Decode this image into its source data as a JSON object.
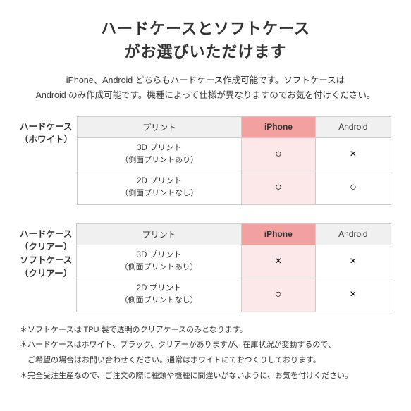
{
  "title": {
    "line1": "ハードケースとソフトケース",
    "line2": "がお選びいただけます"
  },
  "subtitle": "iPhone、Android どちらもハードケース作成可能です。ソフトケースは\nAndroid のみ作成可能です。機種によって仕様が異なりますのでお気を付けください。",
  "section1": {
    "row_label_line1": "ハードケース",
    "row_label_line2": "（ホワイト）",
    "col_print": "プリント",
    "col_iphone": "iPhone",
    "col_android": "Android",
    "rows": [
      {
        "label_line1": "3D プリント",
        "label_line2": "（側面プリントあり）",
        "iphone": "○",
        "android": "×"
      },
      {
        "label_line1": "2D プリント",
        "label_line2": "（側面プリントなし）",
        "iphone": "○",
        "android": "○"
      }
    ]
  },
  "section2": {
    "row_label_hard_line1": "ハードケース",
    "row_label_hard_line2": "（クリアー）",
    "row_label_soft_line1": "ソフトケース",
    "row_label_soft_line2": "（クリアー）",
    "col_print": "プリント",
    "col_iphone": "iPhone",
    "col_android": "Android",
    "rows": [
      {
        "label_line1": "3D プリント",
        "label_line2": "（側面プリントあり）",
        "iphone": "×",
        "android": "×"
      },
      {
        "label_line1": "2D プリント",
        "label_line2": "（側面プリントなし）",
        "iphone": "○",
        "android": "×"
      }
    ]
  },
  "notes": [
    "＊ソフトケースは TPU 製で透明のクリアケースのみとなります。",
    "＊ハードケースはホワイト、ブラック、クリアーがありますが、在庫状況が変動するので、",
    "　ご希望の場合はお問い合わせください。通常はホワイトにておつくりしております。",
    "＊完全受注生産なので、ご注文の際に種類や機種に間違いがないように、お気を付けください。"
  ]
}
